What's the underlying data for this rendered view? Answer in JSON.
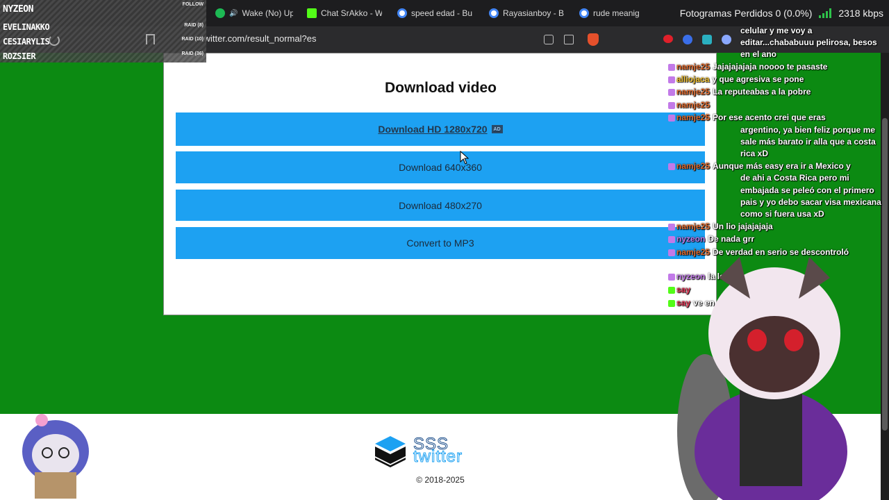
{
  "browser": {
    "tabs": [
      {
        "label": "Wake (No) Up",
        "icon": "spotify-icon",
        "color": "#1db954"
      },
      {
        "label": "Chat SrAkko - W",
        "icon": "kick-icon",
        "color": "#53fc18"
      },
      {
        "label": "speed edad - Bus",
        "icon": "google-icon",
        "color": "#ffffff"
      },
      {
        "label": "Rayasianboy - B",
        "icon": "google-icon",
        "color": "#ffffff"
      },
      {
        "label": "rude meanig",
        "icon": "google-icon",
        "color": "#ffffff"
      }
    ],
    "url": "twitter.com/result_normal?es"
  },
  "stats": {
    "dropped_frames": "Fotogramas Perdidos 0 (0.0%)",
    "bitrate": "2318 kbps"
  },
  "overlay": {
    "follow_name": "NYZEON",
    "follow_tag": "FOLLOW",
    "raids": [
      {
        "name": "EVELINAKKO",
        "tag": "RAID (8)"
      },
      {
        "name": "CESIARYLIS",
        "tag": "RAID (10)"
      },
      {
        "name": "ROZSIER",
        "tag": "RAID (36)"
      }
    ]
  },
  "page": {
    "title": "Download video",
    "buttons": [
      {
        "label": "Download HD 1280x720"
      },
      {
        "label": "Download 640x360"
      },
      {
        "label": "Download 480x270"
      },
      {
        "label": "Convert to MP3"
      }
    ],
    "ad_badge": "AD",
    "logo_line1": "SSS",
    "logo_line2": "twitter",
    "copyright": "© 2018-2025"
  },
  "chat": [
    {
      "user": "",
      "text": "celular y me voy a"
    },
    {
      "user": "",
      "text": "editar...chababuuu pelirosa, besos"
    },
    {
      "user": "",
      "text": "en el ano"
    },
    {
      "user": "namje25",
      "text": "Jajajajajaja noooo te pasaste",
      "color": "#e26a2c"
    },
    {
      "user": "alliojaca",
      "text": "y que agresiva se pone",
      "color": "#f1c232"
    },
    {
      "user": "namje25",
      "text": "La reputeabas a la pobre",
      "color": "#e26a2c"
    },
    {
      "user": "namje25",
      "text": "",
      "color": "#e26a2c"
    },
    {
      "user": "namje25",
      "text": "Por ese acento crei que eras",
      "color": "#e26a2c"
    },
    {
      "user": "",
      "text": "argentino, ya bien feliz porque me"
    },
    {
      "user": "",
      "text": "sale más barato ir alla que a costa"
    },
    {
      "user": "",
      "text": "rica xD"
    },
    {
      "user": "namje25",
      "text": "Aunque más easy era ir a Mexico y",
      "color": "#e26a2c"
    },
    {
      "user": "",
      "text": "de ahi a Costa Rica pero mi"
    },
    {
      "user": "",
      "text": "embajada se peleó con el primero"
    },
    {
      "user": "",
      "text": "pais y yo debo sacar visa mexicana"
    },
    {
      "user": "",
      "text": "como si fuera usa xD"
    },
    {
      "user": "namje25",
      "text": "Un lio jajajajaja",
      "color": "#e26a2c"
    },
    {
      "user": "nyzeon",
      "text": "De nada grr",
      "color": "#c27ae8"
    },
    {
      "user": "namje25",
      "text": "De verdad en serio se descontroló",
      "color": "#e26a2c"
    },
    {
      "user": "nyzeon",
      "text": "la lol",
      "color": "#c27ae8"
    },
    {
      "user": "say",
      "text": "",
      "color": "#e83a5a"
    },
    {
      "user": "say",
      "text": "ve en",
      "color": "#e83a5a"
    }
  ],
  "colors": {
    "page_green": "#0c8a12",
    "button_blue": "#1da1f2"
  }
}
